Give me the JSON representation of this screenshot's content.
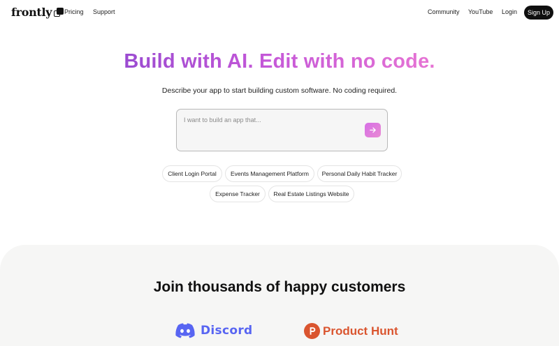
{
  "nav": {
    "logo": "frontly",
    "left_links": [
      "Pricing",
      "Support"
    ],
    "right_links": [
      "Community",
      "YouTube",
      "Login"
    ],
    "signup": "Sign Up"
  },
  "hero": {
    "title": "Build with AI. Edit with no code.",
    "subtitle": "Describe your app to start building custom software. No coding required.",
    "prompt_placeholder": "I want to build an app that...",
    "suggestions": [
      "Client Login Portal",
      "Events Management Platform",
      "Personal Daily Habit Tracker",
      "Expense Tracker",
      "Real Estate Listings Website"
    ]
  },
  "social_proof": {
    "title": "Join thousands of happy customers",
    "logos": [
      "Discord",
      "Product Hunt"
    ]
  },
  "colors": {
    "accent_gradient_start": "#9b4bd1",
    "accent_gradient_end": "#e774d4",
    "discord": "#5865f2",
    "product_hunt": "#da552f"
  }
}
